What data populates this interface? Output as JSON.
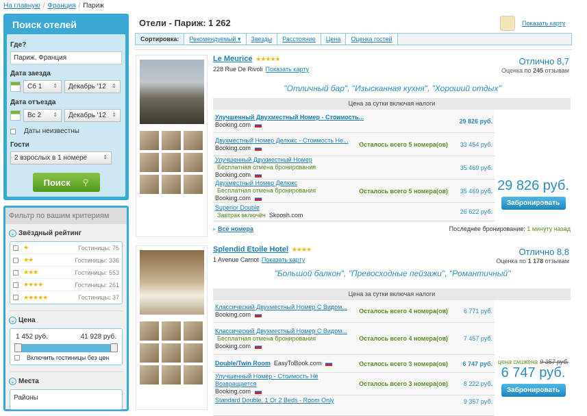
{
  "breadcrumb": [
    "На главную",
    "Франция",
    "Париж"
  ],
  "search": {
    "title": "Поиск отелей",
    "where_label": "Где?",
    "where_value": "Париж, Франция",
    "checkin_label": "Дата заезда",
    "checkin_day": "Сб 1",
    "checkin_month": "Декабрь '12",
    "checkout_label": "Дата отъезда",
    "checkout_day": "Вс 2",
    "checkout_month": "Декабрь '12",
    "dates_unknown": "Даты неизвестны",
    "guests_label": "Гости",
    "guests_value": "2 взрослых в 1 номере",
    "button": "Поиск"
  },
  "filter": {
    "title": "Фильтр по вашим критериям",
    "stars_title": "Звёздный рейтинг",
    "stars": [
      {
        "stars": "★",
        "count": "Гостиницы: 75"
      },
      {
        "stars": "★★",
        "count": "Гостиницы: 336"
      },
      {
        "stars": "★★★",
        "count": "Гостиницы: 553"
      },
      {
        "stars": "★★★★",
        "count": "Гостиницы: 261"
      },
      {
        "stars": "★★★★★",
        "count": "Гостиницы: 37"
      }
    ],
    "price_title": "Цена",
    "price_min": "1 452 руб.",
    "price_max": "41 928 руб.",
    "include_no_price": "Включить гостиницы без цен",
    "places_title": "Места",
    "districts": "Районы"
  },
  "header": {
    "title": "Отели - Париж: 1 262",
    "show_map": "Показать карту"
  },
  "sort": {
    "label": "Сортировка:",
    "options": [
      "Рекомендуемый ▾",
      "Звезды",
      "Расстояние",
      "Цена",
      "Оценка гостей"
    ]
  },
  "hotels": [
    {
      "name": "Le Meurice",
      "stars": "★★★★★",
      "address": "228 Rue De Rivoli",
      "map": "Показать карту",
      "score": "Отлично 8,7",
      "reviews_pre": "Оценка по ",
      "reviews_n": "245",
      "reviews_post": " отзывам",
      "quotes": "\"Отличный бар\",  \"Изысканная кухня\",  \"Хороший отдых\"",
      "table_header": "Цена за сутки включая налоги",
      "rooms": [
        {
          "name": "Улучшенный Двухместный Номер - Стоимость...",
          "extra": "",
          "site": "Booking.com",
          "avail": "",
          "price": "29 826 руб."
        },
        {
          "name": "Двухместный Номер Делюкс - Стоимость Не...",
          "extra": "",
          "site": "Booking.com",
          "avail": "Осталось всего 5 номера(ов)",
          "price": "33 454 руб."
        },
        {
          "name": "Улучшенный Двухместный Номер",
          "extra": "Бесплатная отмена бронирования",
          "site": "Booking.com",
          "avail": "",
          "price": "35 469 руб."
        },
        {
          "name": "Двухместный Номер Делюкс",
          "extra": "Бесплатная отмена бронирования",
          "site": "Booking.com",
          "avail": "Осталось всего 5 номера(ов)",
          "price": "35 469 руб."
        },
        {
          "name": "Superior Double",
          "extra": "Завтрак включён",
          "site": "Skoosh.com",
          "avail": "",
          "price": "26 622 руб."
        }
      ],
      "best_price": "29 826 руб.",
      "book": "Забронировать",
      "all_rooms": "Все номера",
      "last_booking": "Последнее бронирование: ",
      "last_booking_time": "1 минуту назад"
    },
    {
      "name": "Splendid Etoile Hotel",
      "stars": "★★★★",
      "address": "1 Avenue Carnot",
      "map": "Показать карту",
      "score": "Отлично 8,8",
      "reviews_pre": "Оценка по ",
      "reviews_n": "1 178",
      "reviews_post": " отзывам",
      "quotes": "\"Большой балкон\",  \"Превосходные пейзажи\",  \"Романтичный\"",
      "table_header": "Цена за сутки включая налоги",
      "rooms": [
        {
          "name": "Классический Двухместный Номер С Видом...",
          "extra": "",
          "site": "Booking.com",
          "avail": "Осталось всего 4 номера(ов)",
          "price": "6 771 руб."
        },
        {
          "name": "Классический Двухместный Номер С Видом...",
          "extra": "Бесплатная отмена бронирования",
          "site": "Booking.com",
          "avail": "Осталось всего 4 номера(ов)",
          "price": "7 457 руб."
        },
        {
          "name": "Double/Twin Room",
          "extra": "",
          "site": "EasyToBook.com",
          "avail": "Осталось всего 3 номера(ов)",
          "price": "6 747 руб."
        },
        {
          "name": "Улучшенный Номер - Стоимость Не Возвращается",
          "extra": "",
          "site": "Booking.com",
          "avail": "Осталось всего 3 номера(ов)",
          "price": "8 222 руб."
        },
        {
          "name": "Standard Double, 1 Or 2 Beds - Room Only",
          "extra": "",
          "site": "",
          "avail": "",
          "price": "9 357 руб."
        }
      ],
      "discount_label": "цена снижена",
      "old_price": "9 357 руб.",
      "best_price": "6 747 руб.",
      "book": "Забронировать"
    }
  ]
}
